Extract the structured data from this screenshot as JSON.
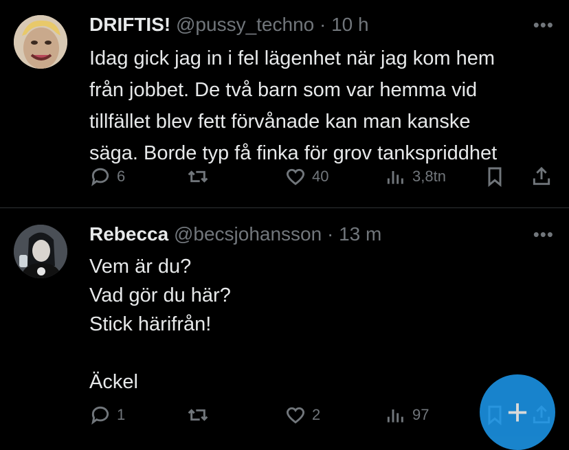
{
  "tweets": [
    {
      "name": "DRIFTIS!",
      "handle": "@pussy_techno",
      "dot": "·",
      "time": "10 h",
      "text": "Idag gick jag in i fel lägenhet när jag kom hem\nfrån jobbet. De två barn som var hemma vid\ntillfället blev fett förvånade kan man kanske\nsäga. Borde typ få finka för grov tankspriddhet",
      "replies": "6",
      "retweets": "",
      "likes": "40",
      "views": "3,8tn"
    },
    {
      "name": "Rebecca",
      "handle": "@becsjohansson",
      "dot": "·",
      "time": "13 m",
      "text": "Vem är du?\nVad gör du här?\nStick härifrån!\n\nÄckel",
      "replies": "1",
      "retweets": "",
      "likes": "2",
      "views": "97"
    }
  ],
  "more_label": "•••",
  "fab_label": "+"
}
